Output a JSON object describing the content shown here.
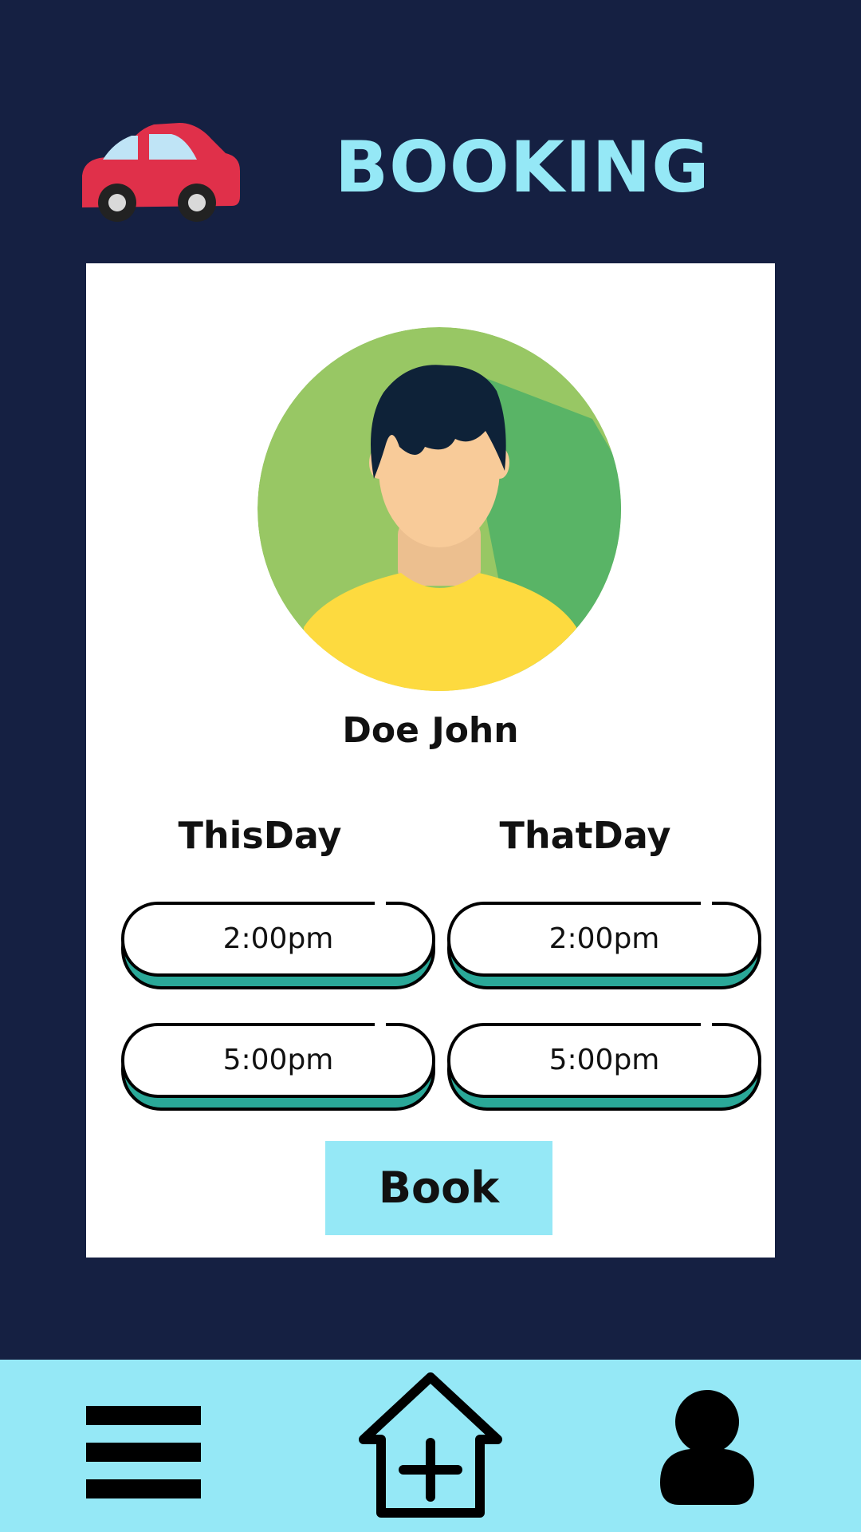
{
  "header": {
    "title": "BOOKING",
    "logo_icon": "car-icon"
  },
  "profile": {
    "name": "Doe John",
    "avatar_icon": "user-avatar-illustration"
  },
  "schedule": {
    "days": [
      {
        "label": "ThisDay",
        "slots": [
          "2:00pm",
          "5:00pm"
        ]
      },
      {
        "label": "ThatDay",
        "slots": [
          "2:00pm",
          "5:00pm"
        ]
      }
    ]
  },
  "actions": {
    "book_label": "Book"
  },
  "nav": {
    "items": [
      {
        "icon": "menu-icon"
      },
      {
        "icon": "home-add-icon"
      },
      {
        "icon": "profile-icon"
      }
    ]
  },
  "colors": {
    "background": "#152042",
    "accent": "#95e8f6",
    "card": "#ffffff",
    "slot_shadow": "#2aa898",
    "car_body": "#e0304a"
  }
}
